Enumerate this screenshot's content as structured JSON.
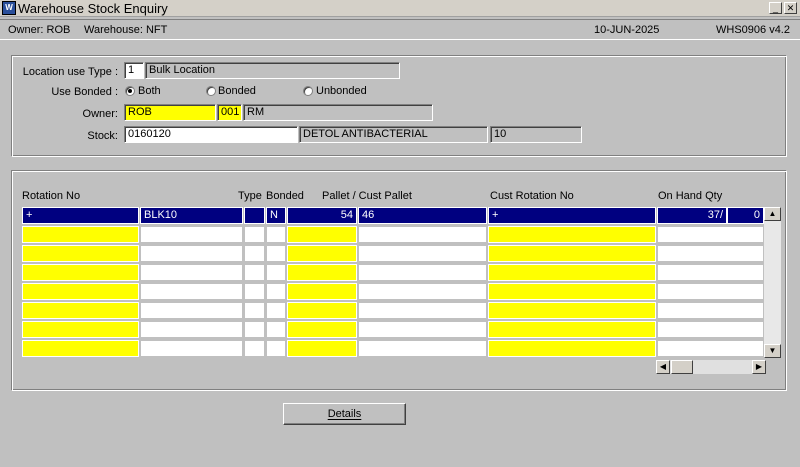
{
  "window": {
    "title": "Warehouse Stock Enquiry"
  },
  "info": {
    "owner_text": "Owner:  ROB",
    "warehouse_text": "Warehouse:  NFT",
    "date": "10-JUN-2025",
    "form_id": "WHS0906  v4.2"
  },
  "form": {
    "location_use_type_label": "Location use Type :",
    "location_use_type_code": "1",
    "location_use_type_desc": "Bulk Location",
    "use_bonded_label": "Use Bonded :",
    "radio_both": "Both",
    "radio_bonded": "Bonded",
    "radio_unbonded": "Unbonded",
    "owner_label": "Owner:",
    "owner_code": "ROB",
    "owner_num": "001",
    "owner_desc": "RM",
    "stock_label": "Stock:",
    "stock_code": "0160120",
    "stock_desc": "DETOL ANTIBACTERIAL",
    "stock_extra": "10"
  },
  "table": {
    "headers": {
      "rotation_no": "Rotation No",
      "type": "Type",
      "bonded": "Bonded",
      "pallet": "Pallet / Cust Pallet",
      "cust_rotation": "Cust Rotation No",
      "on_hand": "On Hand Qty"
    },
    "first_row": {
      "rotation_no": "+",
      "location": "BLK10",
      "type": "",
      "bonded": "N",
      "pallet": "54",
      "cust_pallet": "46",
      "cust_rotation": "+",
      "on_hand": "37/",
      "on_hand_extra": "0"
    }
  },
  "buttons": {
    "details": "Details"
  },
  "icons": {
    "app": "app-icon",
    "minimize": "minimize-icon",
    "close": "close-icon",
    "scroll_up": "arrow-up-icon",
    "scroll_down": "arrow-down-icon",
    "scroll_left": "arrow-left-icon",
    "scroll_right": "arrow-right-icon"
  }
}
